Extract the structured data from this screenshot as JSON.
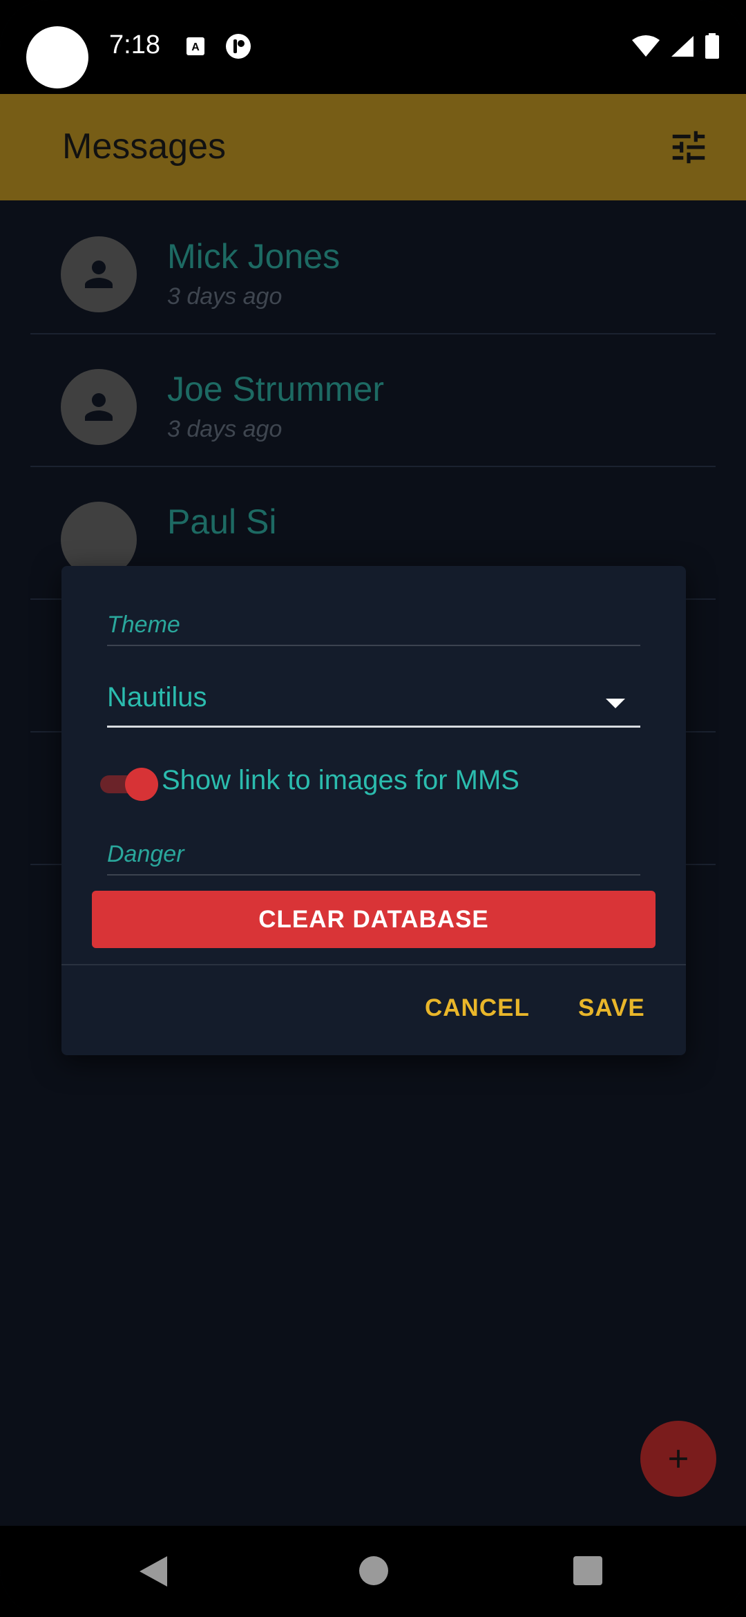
{
  "status_bar": {
    "time": "7:18"
  },
  "app_bar": {
    "title": "Messages",
    "filter_icon": "tune-icon"
  },
  "conversations": [
    {
      "name": "Mick Jones",
      "time": "3 days ago"
    },
    {
      "name": "Joe Strummer",
      "time": "3 days ago"
    },
    {
      "name": "Paul Si",
      "time": ""
    }
  ],
  "dialog": {
    "theme_label": "Theme",
    "theme_value": "Nautilus",
    "mms_toggle_label": "Show link to images for MMS",
    "mms_toggle_on": true,
    "danger_label": "Danger",
    "clear_database_label": "CLEAR DATABASE",
    "cancel_label": "CANCEL",
    "save_label": "SAVE"
  },
  "colors": {
    "app_bar": "#775d16",
    "accent_teal": "#2bbcae",
    "danger_red": "#d93437",
    "action_gold": "#e9b62a",
    "background": "#0b0f18",
    "dialog_bg": "#141c2b"
  }
}
